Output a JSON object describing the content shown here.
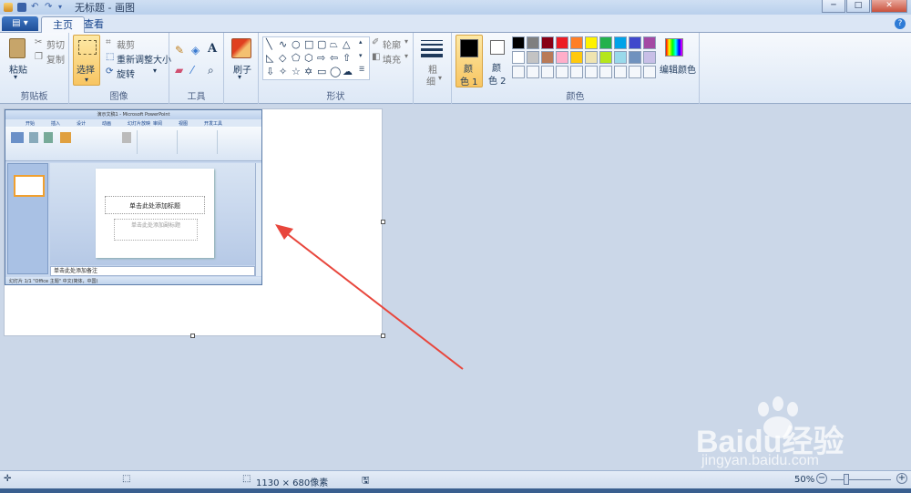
{
  "titlebar": {
    "title": "无标题 - 画图"
  },
  "tabs": {
    "home": "主页",
    "view": "查看"
  },
  "clipboard": {
    "paste": "粘贴",
    "cut": "剪切",
    "copy": "复制",
    "group_label": "剪贴板"
  },
  "image": {
    "select": "选择",
    "crop": "裁剪",
    "resize": "重新调整大小",
    "rotate": "旋转",
    "group_label": "图像"
  },
  "tools": {
    "group_label": "工具"
  },
  "brushes": {
    "label": "刷子"
  },
  "shapes": {
    "outline": "轮廓",
    "fill": "填充",
    "group_label": "形状"
  },
  "size": {
    "label_1": "粗",
    "label_2": "细"
  },
  "colors": {
    "color1": "颜",
    "color1_sub": "色 1",
    "color2": "颜",
    "color2_sub": "色 2",
    "edit": "编辑颜色",
    "group_label": "颜色",
    "color1_value": "#000000",
    "color2_value": "#ffffff",
    "palette_row1": [
      "#000000",
      "#7f7f7f",
      "#880015",
      "#ed1c24",
      "#ff7f27",
      "#fff200",
      "#22b14c",
      "#00a2e8",
      "#3f48cc",
      "#a349a4"
    ],
    "palette_row2": [
      "#ffffff",
      "#c3c3c3",
      "#b97a57",
      "#ffaec9",
      "#ffc90e",
      "#efe4b0",
      "#b5e61d",
      "#99d9ea",
      "#7092be",
      "#c8bfe7"
    ]
  },
  "ppt": {
    "title": "演示文稿1 - Microsoft PowerPoint",
    "tabs": [
      "开始",
      "插入",
      "设计",
      "动画",
      "幻灯片放映",
      "审阅",
      "视图",
      "开发工具"
    ],
    "title_placeholder": "单击此处添加标题",
    "subtitle_placeholder": "单击此处添加副标题",
    "notes": "单击此处添加备注",
    "status": "幻灯片 1/1   \"Office 主题\"   中文(简体，中国)"
  },
  "status": {
    "dimensions": "1130 × 680像素",
    "zoom": "50%"
  },
  "watermark": {
    "brand": "Baidu经验",
    "url": "jingyan.baidu.com"
  },
  "accent": {
    "arrow": "#e8463c",
    "selected": "#f8c562"
  }
}
